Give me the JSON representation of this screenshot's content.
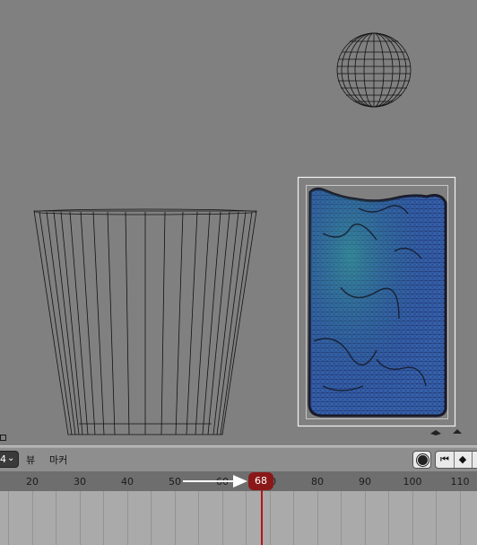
{
  "header": {
    "mode_label": "4",
    "menu_view": "뷰",
    "menu_marker": "마커"
  },
  "icons": {
    "record": "record-icon",
    "jump_start": "jump-to-start-icon",
    "keyframe_prev": "keyframe-prev-icon"
  },
  "timeline": {
    "ruler_labels": [
      "20",
      "30",
      "40",
      "50",
      "60",
      "70",
      "80",
      "90",
      "100",
      "110"
    ],
    "current_frame": "68"
  },
  "colors": {
    "viewport_bg": "#808080",
    "playhead": "#b31515",
    "frame_badge": "#8a1818",
    "fluid_blue": "#2f4fa5"
  }
}
